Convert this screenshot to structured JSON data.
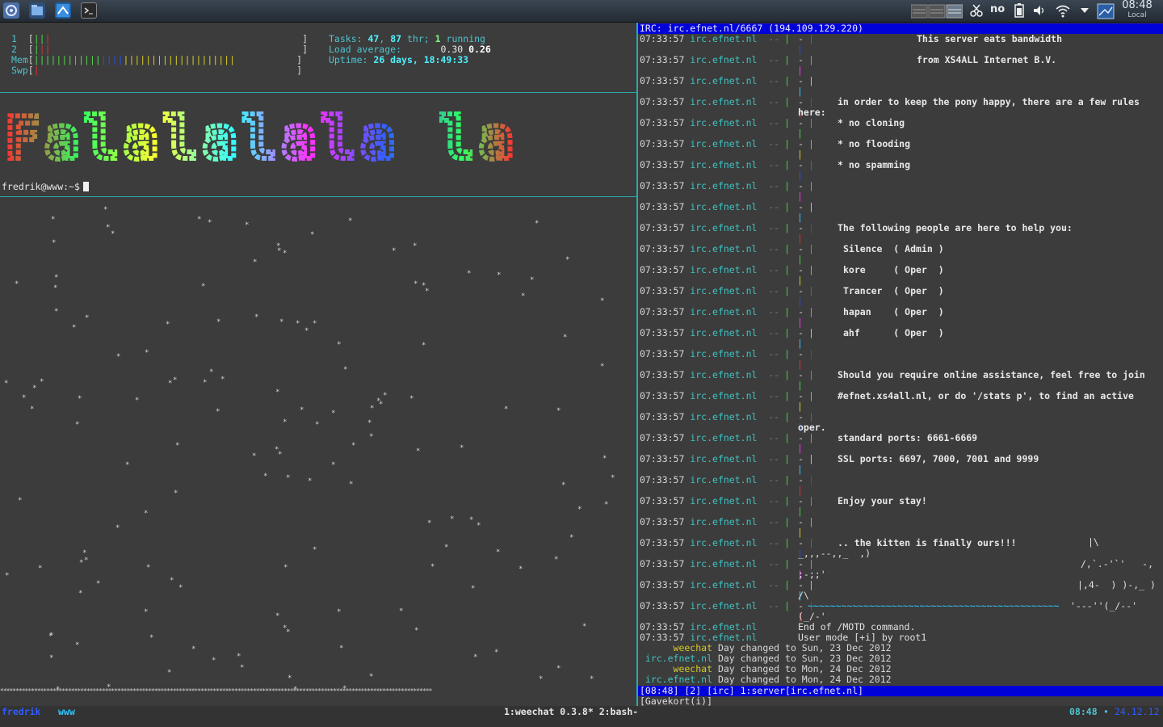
{
  "panel": {
    "tray_no": "no",
    "clock_time": "08:48",
    "clock_label": "Local"
  },
  "htop": {
    "cpu1_label": "1",
    "cpu2_label": "2",
    "mem_label": "Mem",
    "swp_label": "Swp",
    "tasks_label": "Tasks:",
    "tasks": "47",
    "thr": "87",
    "thr_label": "thr;",
    "running": "1",
    "running_label": "running",
    "load_label": "Load average:",
    "load1": "0.30",
    "load2": "0.26",
    "uptime_label": "Uptime:",
    "uptime": "26 days, 18:49:33"
  },
  "banner": {
    "text": "Falalalala la"
  },
  "terminal": {
    "prompt": "fredrik@www:~$"
  },
  "irc": {
    "title": "IRC: irc.efnet.nl/6667 (194.109.129.220)",
    "timestamp": "07:33:57",
    "server": "irc.efnet.nl",
    "motd": [
      "This server eats bandwidth",
      "from XS4ALL Internet B.V.",
      "",
      "in order to keep the pony happy, there are a few rules",
      "* no cloning",
      "* no flooding",
      "* no spamming",
      "",
      "",
      "The following people are here to help you:",
      "Silence  ( Admin )",
      "kore     ( Oper  )",
      "Trancer  ( Oper  )",
      "hapan    ( Oper  )",
      "ahf      ( Oper  )",
      "",
      "Should you require online assistance, feel free to join",
      "#efnet.xs4all.nl, or do '/stats p', to find an active",
      "",
      "standard ports: 6661-6669",
      "SSL ports: 6697, 7000, 7001 and 9999",
      "",
      "Enjoy your stay!",
      "",
      ".. the kitten is finally ours!!!",
      "",
      "",
      "",
      "End of /MOTD command.",
      "User mode [+i] by root1"
    ],
    "motd_wrap": {
      "here": "here:",
      "oper": "oper."
    },
    "art": {
      "a1": "|\\",
      "a2": "_,,,--,,_  ,)",
      "a3": "/,`.-'`'   -,",
      "a4": ";-;;'",
      "a5": "|,4-  ) )-,_ )",
      "a6": "/\\",
      "a7": "'---''(_/--'",
      "a8": "(_/-'"
    },
    "day_changes": [
      {
        "nick": "weechat",
        "text": "Day changed to Sun, 23 Dec 2012"
      },
      {
        "nick": "irc.efnet.nl",
        "text": "Day changed to Sun, 23 Dec 2012"
      },
      {
        "nick": "weechat",
        "text": "Day changed to Mon, 24 Dec 2012"
      },
      {
        "nick": "irc.efnet.nl",
        "text": "Day changed to Mon, 24 Dec 2012"
      }
    ],
    "status_bar": "[08:48] [2] [irc] 1:server[irc.efnet.nl]",
    "input": "[Gavekort(i)]"
  },
  "tmux": {
    "user": "fredrik",
    "host": "www",
    "windows": "1:weechat 0.3.8* 2:bash-",
    "time": "08:48",
    "date": "24.12.12"
  },
  "colors": {
    "cyan": "#4fc3d0",
    "irc_blue": "#0000d8",
    "separator": "#2aa9a9"
  }
}
